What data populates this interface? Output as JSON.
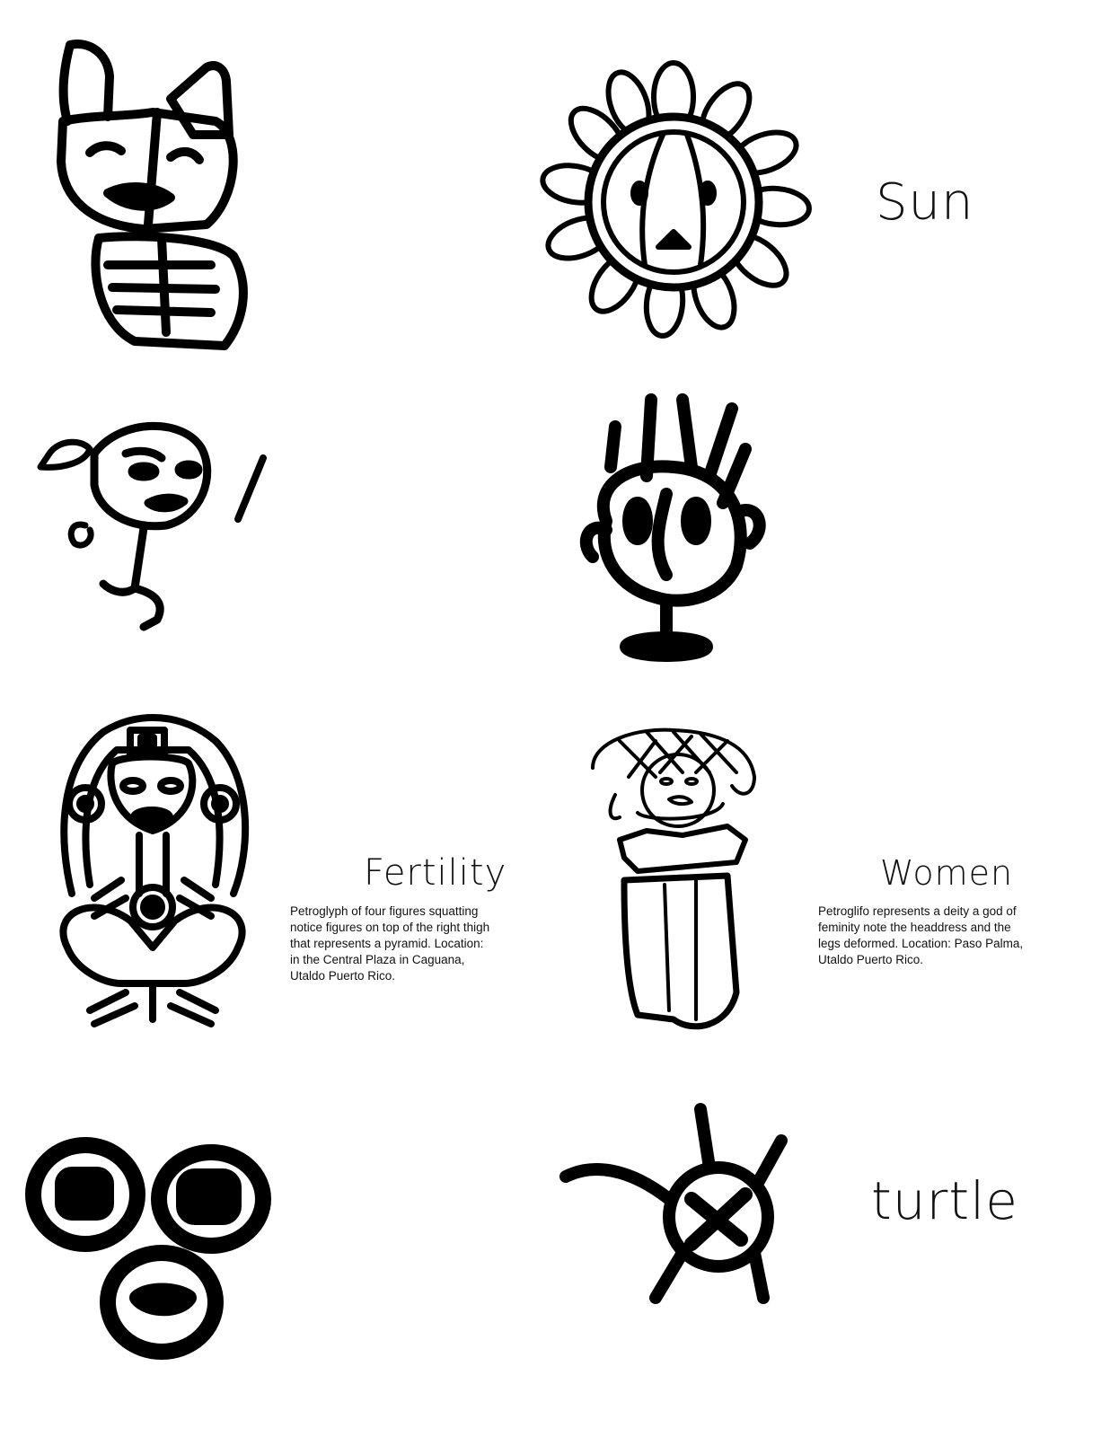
{
  "labels": {
    "sun": "Sun",
    "fertility": "Fertility",
    "women": "Women",
    "turtle": "turtle"
  },
  "captions": {
    "fertility": [
      "Petroglyph of four figures squatting",
      "notice figures on top of the right thigh",
      "that represents a pyramid. Location:",
      "in the Central Plaza in Caguana,",
      "Utaldo Puerto Rico."
    ],
    "women": [
      "Petroglifo represents a  deity a god of",
      "feminity note the  headdress and the",
      "legs deformed. Location: Paso Palma,",
      "Utaldo Puerto Rico."
    ]
  },
  "glyphs": [
    {
      "name": "rabbit-face-petroglyph"
    },
    {
      "name": "sun-petroglyph"
    },
    {
      "name": "stick-figure-petroglyph"
    },
    {
      "name": "cup-face-petroglyph"
    },
    {
      "name": "fertility-figure-petroglyph"
    },
    {
      "name": "women-deity-petroglyph"
    },
    {
      "name": "three-rings-petroglyph"
    },
    {
      "name": "turtle-petroglyph"
    }
  ],
  "colors": {
    "ink": "#000000",
    "background": "#ffffff"
  }
}
